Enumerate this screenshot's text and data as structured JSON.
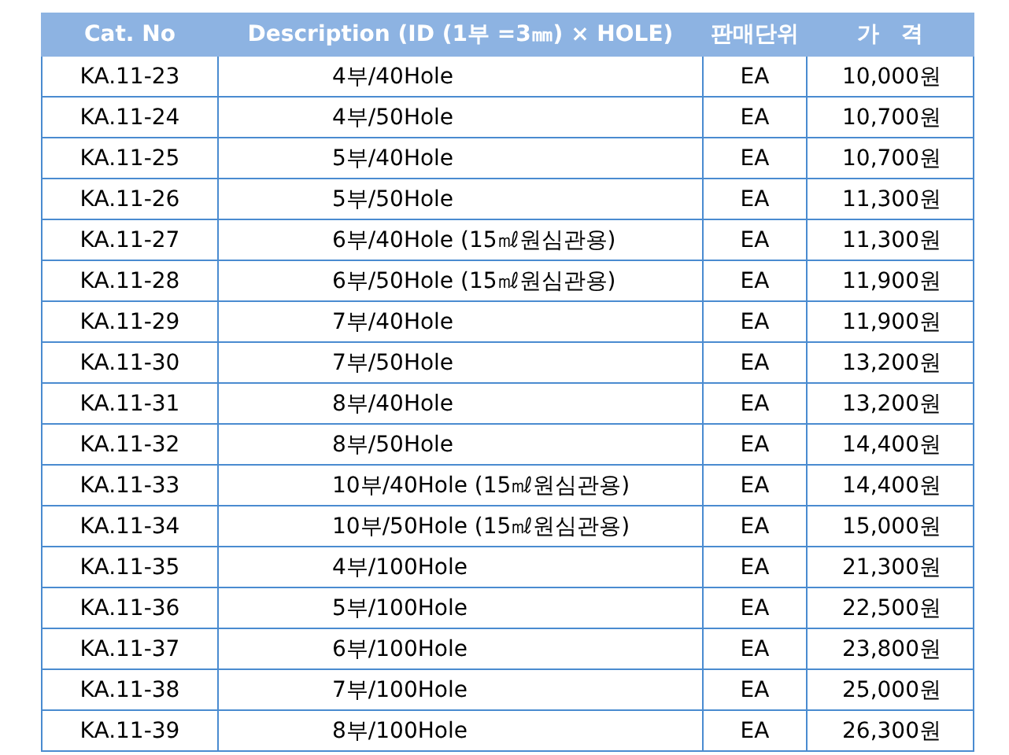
{
  "table": {
    "columns": [
      "Cat. No",
      "Description  (ID (1부 =3㎜) × HOLE)",
      "판매단위",
      "가　격"
    ],
    "rows": [
      [
        "KA.11-23",
        "4부/40Hole",
        "EA",
        "10,000원"
      ],
      [
        "KA.11-24",
        "4부/50Hole",
        "EA",
        "10,700원"
      ],
      [
        "KA.11-25",
        "5부/40Hole",
        "EA",
        "10,700원"
      ],
      [
        "KA.11-26",
        "5부/50Hole",
        "EA",
        "11,300원"
      ],
      [
        "KA.11-27",
        "6부/40Hole (15㎖원심관용)",
        "EA",
        "11,300원"
      ],
      [
        "KA.11-28",
        "6부/50Hole (15㎖원심관용)",
        "EA",
        "11,900원"
      ],
      [
        "KA.11-29",
        "7부/40Hole",
        "EA",
        "11,900원"
      ],
      [
        "KA.11-30",
        "7부/50Hole",
        "EA",
        "13,200원"
      ],
      [
        "KA.11-31",
        "8부/40Hole",
        "EA",
        "13,200원"
      ],
      [
        "KA.11-32",
        "8부/50Hole",
        "EA",
        "14,400원"
      ],
      [
        "KA.11-33",
        "10부/40Hole (15㎖원심관용)",
        "EA",
        "14,400원"
      ],
      [
        "KA.11-34",
        "10부/50Hole (15㎖원심관용)",
        "EA",
        "15,000원"
      ],
      [
        "KA.11-35",
        "4부/100Hole",
        "EA",
        "21,300원"
      ],
      [
        "KA.11-36",
        "5부/100Hole",
        "EA",
        "22,500원"
      ],
      [
        "KA.11-37",
        "6부/100Hole",
        "EA",
        "23,800원"
      ],
      [
        "KA.11-38",
        "7부/100Hole",
        "EA",
        "25,000원"
      ],
      [
        "KA.11-39",
        "8부/100Hole",
        "EA",
        "26,300원"
      ]
    ]
  }
}
